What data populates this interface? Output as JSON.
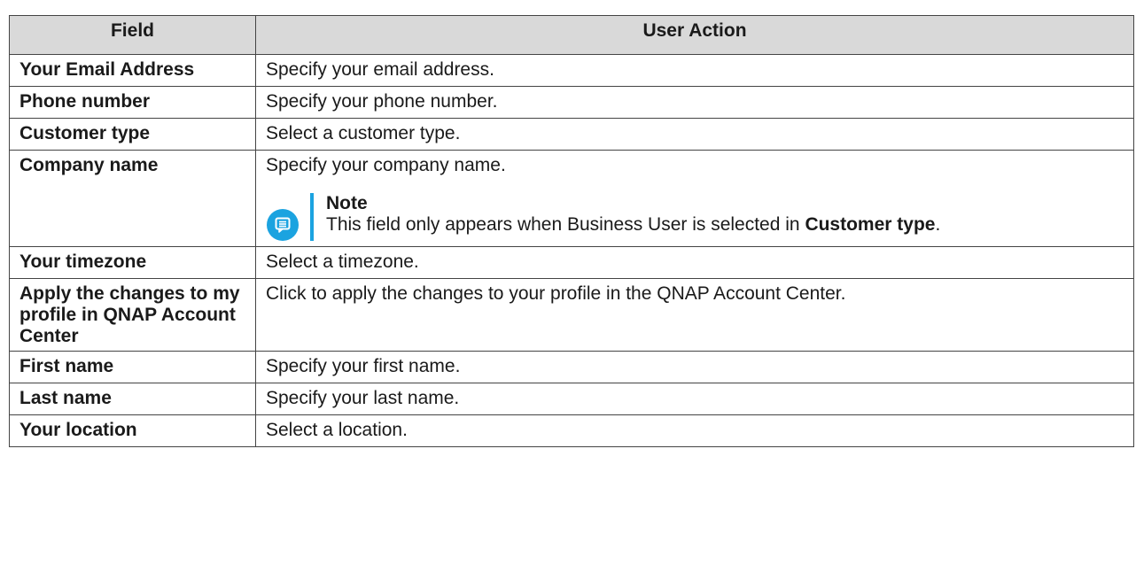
{
  "header": {
    "col_field": "Field",
    "col_action": "User Action"
  },
  "rows": [
    {
      "field": "Your Email Address",
      "action": "Specify your email address."
    },
    {
      "field": "Phone number",
      "action": "Specify your phone number."
    },
    {
      "field": "Customer type",
      "action": "Select a customer type."
    },
    {
      "field": "Company name",
      "action": "Specify your company name."
    },
    {
      "field": "Your timezone",
      "action": "Select a timezone."
    },
    {
      "field": "Apply the changes to my profile in QNAP Account Center",
      "action": "Click to apply the changes to your profile in the QNAP Account Center."
    },
    {
      "field": "First name",
      "action": "Specify your first name."
    },
    {
      "field": "Last name",
      "action": "Specify your last name."
    },
    {
      "field": "Your location",
      "action": "Select a location."
    }
  ],
  "note": {
    "icon": "note-icon",
    "title": "Note",
    "text_before": "This field only appears when Business User is selected in ",
    "text_bold": "Customer type",
    "text_after": ".",
    "accent_color": "#1ba3e0"
  },
  "colors": {
    "header_bg": "#d9d9d9",
    "border": "#444444",
    "note_accent": "#1ba3e0"
  }
}
